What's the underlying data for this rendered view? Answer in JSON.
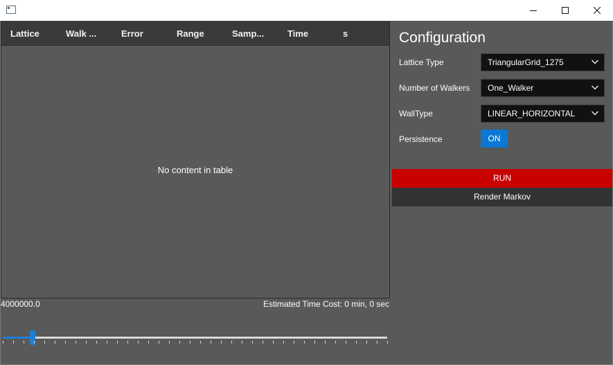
{
  "window": {
    "icon": "app-icon",
    "controls": [
      "minimize-icon",
      "maximize-icon",
      "close-icon"
    ]
  },
  "table": {
    "columns": [
      "Lattice",
      "Walk ...",
      "Error",
      "Range",
      "Samp...",
      "Time",
      "s"
    ],
    "empty_message": "No content in table"
  },
  "status": {
    "value": "4000000.0",
    "estimate": "Estimated Time Cost: 0 min, 0 sec"
  },
  "slider": {
    "position_fraction": 0.078,
    "tick_count": 38
  },
  "config": {
    "title": "Configuration",
    "lattice_type": {
      "label": "Lattice Type",
      "value": "TriangularGrid_1275"
    },
    "walkers": {
      "label": "Number of Walkers",
      "value": "One_Walker"
    },
    "wall_type": {
      "label": "WallType",
      "value": "LINEAR_HORIZONTAL"
    },
    "persistence": {
      "label": "Persistence",
      "value": "ON"
    },
    "run_label": "RUN",
    "render_label": "Render Markov"
  },
  "colors": {
    "background": "#595959",
    "header": "#3a3a3a",
    "accent": "#0a78d4",
    "run": "#c80000",
    "dropdown": "#111111"
  }
}
